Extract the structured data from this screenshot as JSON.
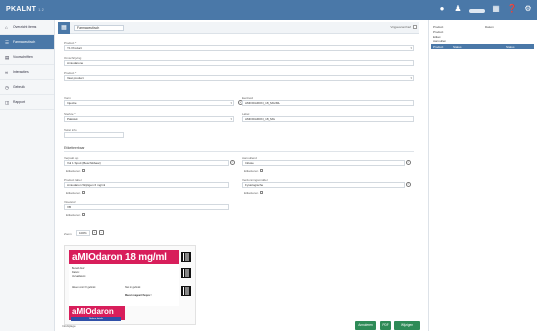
{
  "app": {
    "logo": "PKALNT",
    "logo_sub": "1.2"
  },
  "topbar": {
    "icons": [
      "bell-icon",
      "user-icon",
      "grid-icon",
      "help-icon",
      "gear-icon"
    ]
  },
  "sidebar": {
    "items": [
      {
        "label": "Overzicht items",
        "icon": "home-icon",
        "active": false
      },
      {
        "label": "Farmaceutisch",
        "icon": "list-icon",
        "active": true
      },
      {
        "label": "Voorschriften",
        "icon": "doc-icon",
        "active": false
      },
      {
        "label": "Interacties",
        "icon": "link-icon",
        "active": false
      },
      {
        "label": "Gebruik",
        "icon": "clock-icon",
        "active": false
      },
      {
        "label": "Rapport",
        "icon": "chart-icon",
        "active": false
      }
    ]
  },
  "subbar": {
    "title": "Farmaceutisch",
    "right_label": "Vrijgave/archief"
  },
  "form": {
    "f1_label": "Product *",
    "f1_value": "Y1 Product",
    "f2_label": "Omschrijving",
    "f2_value": "Amiodarone",
    "f3_label": "Product *",
    "f3_value": "Vast product",
    "f4_label": "Vorm",
    "f4_value": "Injectie",
    "f5_label": "Eenheid",
    "f5_value": "AMIODARON_18_MG/ML",
    "f6_label": "Sterkte *",
    "f6_value": "Pakstuk",
    "f7_label": "Label",
    "f7_value": "AMIODARON_18_MG",
    "f8_label": "Tekst info",
    "f8_value": "",
    "section_label": "Etiketteerbaar",
    "s1_label": "Verpakt op",
    "s1_value": "Vul 1 Spuit (Beschikbaar)",
    "s1_check": "Etiketteren",
    "s2_label": "Aanvullend",
    "s2_value": "Infusie",
    "s2_check": "Etiketteren",
    "s3_label": "Product label",
    "s3_value": "Amiodaron Wijzigen 6 mg/ml",
    "s3_check": "Etiketteren",
    "s4_label": "Verdunningsmiddel",
    "s4_value": "Fysiologische",
    "s4_check": "Etiketteren",
    "s5_label": "Vloeistof",
    "s5_value": "VB",
    "s5_check": "Etiketteren",
    "zoom_label": "Zoom",
    "zoom_value": "100%"
  },
  "drug_label": {
    "brand": "aMIOdaron 18 mg/ml",
    "line1": "Bereid door:",
    "line2": "Datum:",
    "line3": "Vervaldatum:",
    "line4": "Alleen voor IV gebruik",
    "line5": "Niet in gebruik",
    "line6": "Meest reageert flesjes !",
    "brand2": "aMIOdaron",
    "tag": "Nadere details"
  },
  "bottom": {
    "footer_text": "Infobijlage",
    "btn_annuleren": "Annuleren",
    "btn_pdf": "PDF",
    "btn_wijzigen": "Wijzigen",
    "btn_opslaan": "Opslaan",
    "btn_ok": "OK",
    "icons": [
      "folder-icon",
      "copy-icon",
      "print-icon",
      "info-icon"
    ]
  },
  "right_panel": {
    "line1": "Product",
    "line2": "Product",
    "line3": "Etiket",
    "line4": "Aanvullen",
    "header_col1": "Product",
    "header_col2": "Status",
    "header_col3": "Status",
    "top_right": "Datum"
  },
  "colors": {
    "accent": "#4a78a8",
    "green": "#2e8b57",
    "magenta": "#d81e5b",
    "navy": "#2f4fa8"
  }
}
